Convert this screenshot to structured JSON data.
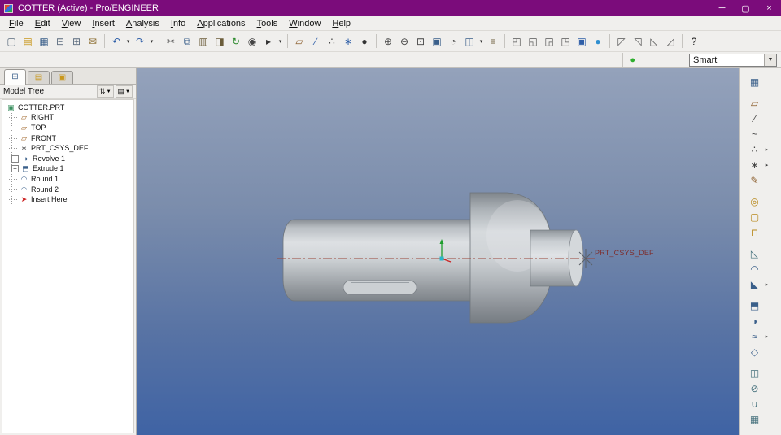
{
  "window": {
    "title": "COTTER (Active) - Pro/ENGINEER",
    "controls": [
      {
        "name": "minimize-button",
        "glyph": "─"
      },
      {
        "name": "maximize-button",
        "glyph": "▢"
      },
      {
        "name": "close-button",
        "glyph": "×"
      }
    ]
  },
  "menu": {
    "items": [
      "File",
      "Edit",
      "View",
      "Insert",
      "Analysis",
      "Info",
      "Applications",
      "Tools",
      "Window",
      "Help"
    ]
  },
  "toolbar": {
    "groups": [
      {
        "items": [
          {
            "name": "new-file",
            "glyph": "▢",
            "color": "#5a6b7d"
          },
          {
            "name": "open-file",
            "glyph": "▤",
            "color": "#c9971c"
          },
          {
            "name": "save-file",
            "glyph": "▦",
            "color": "#3a5f8a"
          },
          {
            "name": "print",
            "glyph": "⊟",
            "color": "#5a6b7d"
          },
          {
            "name": "print-preview",
            "glyph": "⊞",
            "color": "#5a6b7d"
          },
          {
            "name": "send-mail",
            "glyph": "✉",
            "color": "#8a6b2d"
          }
        ]
      },
      {
        "items": [
          {
            "name": "undo",
            "glyph": "↶",
            "color": "#2f5fa8",
            "flyout": true
          },
          {
            "name": "redo",
            "glyph": "↷",
            "color": "#2f5fa8",
            "flyout": true
          }
        ]
      },
      {
        "items": [
          {
            "name": "cut",
            "glyph": "✂",
            "color": "#555555"
          },
          {
            "name": "copy",
            "glyph": "⧉",
            "color": "#3a5f8a"
          },
          {
            "name": "paste",
            "glyph": "▥",
            "color": "#6b5d3a"
          },
          {
            "name": "paste-special",
            "glyph": "◨",
            "color": "#6b5d3a"
          },
          {
            "name": "regenerate",
            "glyph": "↻",
            "color": "#2e8b2e"
          },
          {
            "name": "find",
            "glyph": "◉",
            "color": "#444444"
          },
          {
            "name": "select",
            "glyph": "▸",
            "color": "#333333",
            "flyout": true
          }
        ]
      },
      {
        "items": [
          {
            "name": "datum-plane-display",
            "glyph": "▱",
            "color": "#8a5c2a"
          },
          {
            "name": "datum-axis-display",
            "glyph": "∕",
            "color": "#2f5fa8"
          },
          {
            "name": "point-display",
            "glyph": "∴",
            "color": "#444444"
          },
          {
            "name": "csys-display",
            "glyph": "∗",
            "color": "#2f5fa8"
          },
          {
            "name": "spin-center-display",
            "glyph": "●",
            "color": "#333333"
          }
        ]
      },
      {
        "items": [
          {
            "name": "zoom-in",
            "glyph": "⊕",
            "color": "#444444"
          },
          {
            "name": "zoom-out",
            "glyph": "⊖",
            "color": "#444444"
          },
          {
            "name": "refit",
            "glyph": "⊡",
            "color": "#444444"
          },
          {
            "name": "repaint",
            "glyph": "▣",
            "color": "#3a5f8a"
          },
          {
            "name": "reorient",
            "glyph": "◔",
            "color": "#444444"
          },
          {
            "name": "saved-views",
            "glyph": "◫",
            "color": "#3a5f8a",
            "flyout": true
          },
          {
            "name": "layers",
            "glyph": "≡",
            "color": "#6b5d3a"
          }
        ]
      },
      {
        "items": [
          {
            "name": "wireframe-display",
            "glyph": "◰",
            "color": "#555555"
          },
          {
            "name": "hidden-line-display",
            "glyph": "◱",
            "color": "#555555"
          },
          {
            "name": "no-hidden-display",
            "glyph": "◲",
            "color": "#555555"
          },
          {
            "name": "shaded-display",
            "glyph": "◳",
            "color": "#555555"
          },
          {
            "name": "activate-window",
            "glyph": "▣",
            "color": "#2f5fa8"
          },
          {
            "name": "model-info",
            "glyph": "●",
            "color": "#2f8fd0"
          }
        ]
      },
      {
        "items": [
          {
            "name": "annotation-display",
            "glyph": "◸",
            "color": "#555555"
          },
          {
            "name": "enhanced-realism",
            "glyph": "◹",
            "color": "#555555"
          },
          {
            "name": "perspective-view",
            "glyph": "◺",
            "color": "#555555"
          },
          {
            "name": "view-normal",
            "glyph": "◿",
            "color": "#555555"
          }
        ]
      },
      {
        "items": [
          {
            "name": "context-help",
            "glyph": "?",
            "color": "#222222"
          }
        ]
      }
    ]
  },
  "toolbar2": {
    "status_icon": {
      "name": "model-status",
      "glyph": "●",
      "color": "#2eae2e"
    },
    "filter": {
      "value": "Smart"
    }
  },
  "left_panel": {
    "tabs": [
      {
        "name": "model-tree-tab",
        "glyph": "⊞",
        "color": "#3a5f8a",
        "active": true
      },
      {
        "name": "folder-browser-tab",
        "glyph": "▤",
        "color": "#c9971c",
        "active": false
      },
      {
        "name": "favorites-tab",
        "glyph": "▣",
        "color": "#c9971c",
        "active": false
      }
    ],
    "header": {
      "title": "Model Tree",
      "buttons": [
        {
          "name": "show-menu-button",
          "glyph": "⇅"
        },
        {
          "name": "settings-menu-button",
          "glyph": "▤"
        }
      ]
    },
    "tree": [
      {
        "label": "COTTER.PRT",
        "icon": "part-icon",
        "glyph": "▣",
        "color": "#3a8f5f",
        "level": 0
      },
      {
        "label": "RIGHT",
        "icon": "datum-plane-icon",
        "glyph": "▱",
        "color": "#a0662a",
        "level": 1
      },
      {
        "label": "TOP",
        "icon": "datum-plane-icon",
        "glyph": "▱",
        "color": "#a0662a",
        "level": 1
      },
      {
        "label": "FRONT",
        "icon": "datum-plane-icon",
        "glyph": "▱",
        "color": "#a0662a",
        "level": 1
      },
      {
        "label": "PRT_CSYS_DEF",
        "icon": "csys-icon",
        "glyph": "∗",
        "color": "#555555",
        "level": 1
      },
      {
        "label": "Revolve 1",
        "icon": "revolve-icon",
        "glyph": "◑",
        "color": "#3a5f8a",
        "level": 1,
        "expander": true
      },
      {
        "label": "Extrude 1",
        "icon": "extrude-icon",
        "glyph": "⬒",
        "color": "#3a5f8a",
        "level": 1,
        "expander": true
      },
      {
        "label": "Round 1",
        "icon": "round-icon",
        "glyph": "◠",
        "color": "#3a5f8a",
        "level": 1
      },
      {
        "label": "Round 2",
        "icon": "round-icon",
        "glyph": "◠",
        "color": "#3a5f8a",
        "level": 1
      },
      {
        "label": "Insert Here",
        "icon": "insert-here-icon",
        "glyph": "➤",
        "color": "#cc2222",
        "level": 1
      }
    ]
  },
  "viewport": {
    "csys_label": "PRT_CSYS_DEF",
    "model_name": "cotter-3d-model"
  },
  "right_toolbar": {
    "groups": [
      {
        "items": [
          {
            "name": "view-manager",
            "glyph": "▦",
            "color": "#3a5f8a"
          }
        ]
      },
      {
        "items": [
          {
            "name": "datum-plane-tool",
            "glyph": "▱",
            "color": "#8a5c2a"
          },
          {
            "name": "datum-axis-tool",
            "glyph": "∕",
            "color": "#444444"
          },
          {
            "name": "datum-curve-tool",
            "glyph": "~",
            "color": "#444444"
          },
          {
            "name": "datum-point-tool",
            "glyph": "∴",
            "color": "#444444",
            "flyout": true
          },
          {
            "name": "csys-tool",
            "glyph": "∗",
            "color": "#444444",
            "flyout": true
          },
          {
            "name": "sketch-tool",
            "glyph": "✎",
            "color": "#8a5c2a"
          }
        ]
      },
      {
        "items": [
          {
            "name": "hole-tool",
            "glyph": "◎",
            "color": "#b8891c"
          },
          {
            "name": "shell-tool",
            "glyph": "▢",
            "color": "#b8891c"
          },
          {
            "name": "rib-tool",
            "glyph": "⊓",
            "color": "#b8891c"
          }
        ]
      },
      {
        "items": [
          {
            "name": "draft-tool",
            "glyph": "◺",
            "color": "#44707c"
          },
          {
            "name": "round-tool",
            "glyph": "◠",
            "color": "#3a5f8a"
          },
          {
            "name": "chamfer-tool",
            "glyph": "◣",
            "color": "#3a5f8a",
            "flyout": true
          }
        ]
      },
      {
        "items": [
          {
            "name": "extrude-tool",
            "glyph": "⬒",
            "color": "#3a5f8a"
          },
          {
            "name": "revolve-tool",
            "glyph": "◑",
            "color": "#3a5f8a"
          },
          {
            "name": "sweep-tool",
            "glyph": "≈",
            "color": "#3a5f8a",
            "flyout": true
          },
          {
            "name": "blend-tool",
            "glyph": "◇",
            "color": "#3a5f8a"
          }
        ]
      },
      {
        "items": [
          {
            "name": "mirror-tool",
            "glyph": "◫",
            "color": "#44707c"
          },
          {
            "name": "trim-tool",
            "glyph": "⊘",
            "color": "#44707c"
          },
          {
            "name": "merge-tool",
            "glyph": "∪",
            "color": "#44707c"
          },
          {
            "name": "pattern-tool",
            "glyph": "▦",
            "color": "#44707c"
          }
        ]
      }
    ]
  }
}
